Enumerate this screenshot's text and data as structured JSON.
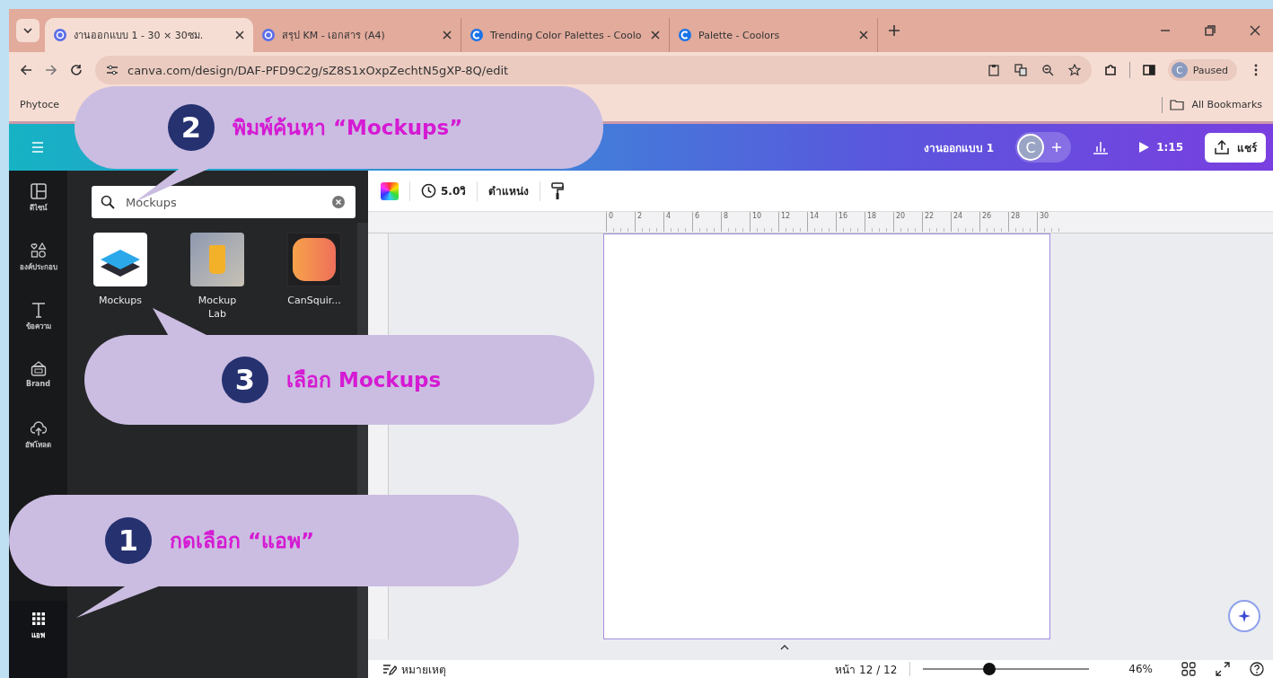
{
  "browser": {
    "tabs": [
      {
        "title": "งานออกแบบ 1 - 30 × 30ซม.",
        "selected": true
      },
      {
        "title": "สรุป KM - เอกสาร (A4)",
        "selected": false
      },
      {
        "title": "Trending Color Palettes - Coolo",
        "selected": false
      },
      {
        "title": "Palette - Coolors",
        "selected": false
      }
    ],
    "url": "canva.com/design/DAF-PFD9C2g/sZ8S1xOxpZechtN5gXP-8Q/edit",
    "profile": {
      "initial": "C",
      "status": "Paused"
    },
    "bookmark": "Phytoce",
    "all_bookmarks": "All Bookmarks"
  },
  "editor": {
    "header": {
      "design_title": "งานออกแบบ 1",
      "avatar": "C",
      "present_time": "1:15",
      "share": "แชร์"
    },
    "rail": [
      {
        "label": "ดีไซน์",
        "selected": false
      },
      {
        "label": "องค์ประกอบ",
        "selected": false
      },
      {
        "label": "ข้อความ",
        "selected": false
      },
      {
        "label": "Brand",
        "selected": false
      },
      {
        "label": "อัพโหลด",
        "selected": false
      },
      {
        "label": "แอพ",
        "selected": true
      }
    ],
    "search": {
      "value": "Mockups"
    },
    "apps": [
      {
        "name": "Mockups",
        "kind": "layers"
      },
      {
        "name": "Mockup Lab",
        "kind": "photo"
      },
      {
        "name": "CanSquir...",
        "kind": "gradient"
      }
    ],
    "toolbar": {
      "duration": "5.0วิ",
      "position": "ตำแหน่ง"
    },
    "ruler": [
      "0",
      "2",
      "4",
      "6",
      "8",
      "10",
      "12",
      "14",
      "16",
      "18",
      "20",
      "22",
      "24",
      "26",
      "28",
      "30"
    ],
    "footer": {
      "notes": "หมายเหตุ",
      "page": "หน้า 12 / 12",
      "zoom": {
        "level": 0.4
      },
      "zoom_reading": "46%"
    }
  },
  "callouts": [
    {
      "number": "2",
      "text": "พิมพ์ค้นหา “Mockups”"
    },
    {
      "number": "3",
      "text": "เลือก Mockups"
    },
    {
      "number": "1",
      "text": "กดเลือก “แอพ”"
    }
  ]
}
